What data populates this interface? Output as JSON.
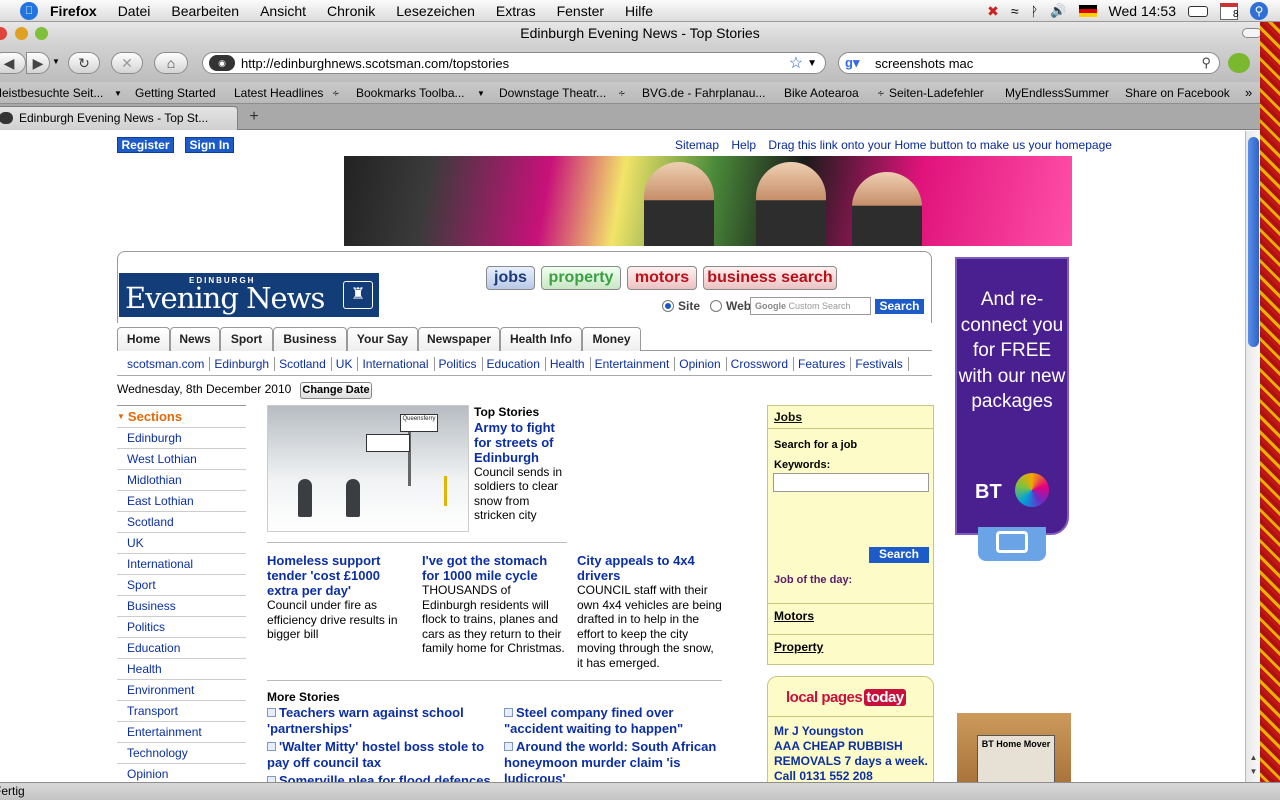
{
  "menubar": {
    "app": "Firefox",
    "items": [
      "Datei",
      "Bearbeiten",
      "Ansicht",
      "Chronik",
      "Lesezeichen",
      "Extras",
      "Fenster",
      "Hilfe"
    ],
    "clock": "Wed 14:53",
    "calendar_day": "8"
  },
  "window": {
    "title": "Edinburgh Evening News - Top Stories"
  },
  "toolbar": {
    "url": "http://edinburghnews.scotsman.com/topstories",
    "search_value": "screenshots mac"
  },
  "bookmarks": [
    "Meistbesuchte Seit...",
    "Getting Started",
    "Latest Headlines",
    "Bookmarks Toolba...",
    "Downstage Theatr...",
    "BVG.de - Fahrplanau...",
    "Bike Aotearoa",
    "Seiten-Ladefehler",
    "MyEndlessSummer",
    "Share on Facebook"
  ],
  "tab": {
    "label": "Edinburgh Evening News - Top St..."
  },
  "status": "Fertig",
  "page": {
    "register": "Register",
    "signin": "Sign In",
    "toplinks": [
      "Sitemap",
      "Help",
      "Drag this link onto your Home button to make us your homepage"
    ],
    "logo": {
      "small": "EDINBURGH",
      "big": "Evening News"
    },
    "classifieds": [
      "jobs",
      "property",
      "motors",
      "business search"
    ],
    "search": {
      "site_label": "Site",
      "web_label": "Web",
      "placeholder": "Custom Search",
      "google": "Google",
      "button": "Search"
    },
    "mainnav": [
      "Home",
      "News",
      "Sport",
      "Business",
      "Your Say",
      "Newspaper",
      "Health Info",
      "Money"
    ],
    "subnav": [
      "scotsman.com",
      "Edinburgh",
      "Scotland",
      "UK",
      "International",
      "Politics",
      "Education",
      "Health",
      "Entertainment",
      "Opinion",
      "Crossword",
      "Features",
      "Festivals"
    ],
    "date": "Wednesday, 8th December 2010",
    "change_date": "Change Date",
    "sections": {
      "heading": "Sections",
      "items": [
        "Edinburgh",
        "West Lothian",
        "Midlothian",
        "East Lothian",
        "Scotland",
        "UK",
        "International",
        "Sport",
        "Business",
        "Politics",
        "Education",
        "Health",
        "Environment",
        "Transport",
        "Entertainment",
        "Technology",
        "Opinion"
      ]
    },
    "top_story": {
      "kicker": "Top Stories",
      "headline": "Army to fight for streets of Edinburgh",
      "summary": "Council sends in soldiers to clear snow from stricken city"
    },
    "stories": [
      {
        "headline": "Homeless support tender 'cost £1000 extra per day'",
        "summary": "Council under fire as efficiency drive results in bigger bill"
      },
      {
        "headline": "I've got the stomach for 1000 mile cycle",
        "summary": "THOUSANDS of Edinburgh residents will flock to trains, planes and cars as they return to their family home for Christmas."
      },
      {
        "headline": "City appeals to 4x4 drivers",
        "summary": "COUNCIL staff with their own 4x4 vehicles are being drafted in to help in the effort to keep the city moving through the snow, it has emerged."
      }
    ],
    "more_stories": {
      "heading": "More Stories",
      "items": [
        "Teachers warn against school 'partnerships'",
        "Steel company fined over \"accident waiting to happen\"",
        "'Walter Mitty' hostel boss stole to pay off council tax",
        "Around the world: South African honeymoon murder claim 'is ludicrous'",
        "Somerville plea for flood defences"
      ]
    },
    "jobs_box": {
      "title": "Jobs",
      "search_label": "Search for a job",
      "keywords_label": "Keywords:",
      "search_button": "Search",
      "job_of_day": "Job of the day:",
      "motors": "Motors",
      "property": "Property"
    },
    "local_pages": {
      "brand": "local pages",
      "brand_tag": "today",
      "ad_lines": [
        "Mr J Youngston",
        "AAA CHEAP RUBBISH",
        "REMOVALS 7 days a week.",
        "Call 0131 552 208"
      ]
    },
    "bt_ad": {
      "text": "And re-connect you for FREE with our new packages",
      "brand": "BT"
    },
    "box_ad": {
      "label": "BT Home Mover"
    },
    "sign_text": "Queensferry"
  }
}
